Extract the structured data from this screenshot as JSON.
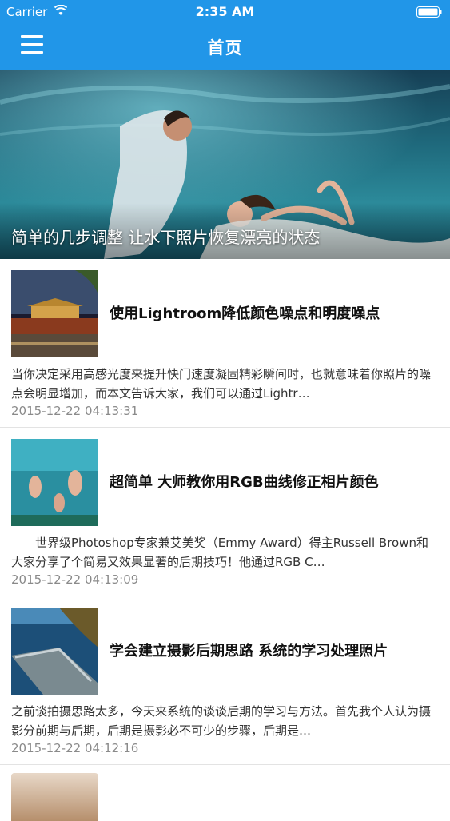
{
  "status_bar": {
    "carrier": "Carrier",
    "time": "2:35 AM"
  },
  "nav": {
    "title": "首页",
    "menu_icon": "hamburger-menu-icon"
  },
  "hero": {
    "caption": "简单的几步调整 让水下照片恢复漂亮的状态"
  },
  "articles": [
    {
      "title": "使用Lightroom降低颜色噪点和明度噪点",
      "summary": "当你决定采用高感光度来提升快门速度凝固精彩瞬间时，也就意味着你照片的噪点会明显增加，而本文告诉大家，我们可以通过Lightr…",
      "date": "2015-12-22 04:13:31"
    },
    {
      "title": "超简单 大师教你用RGB曲线修正相片颜色",
      "summary": "　　世界级Photoshop专家兼艾美奖（Emmy Award）得主Russell Brown和大家分享了个简易又效果显著的后期技巧！他通过RGB C…",
      "date": "2015-12-22 04:13:09"
    },
    {
      "title": "学会建立摄影后期思路 系统的学习处理照片",
      "summary": "之前谈拍摄思路太多，今天来系统的谈谈后期的学习与方法。首先我个人认为摄影分前期与后期，后期是摄影必不可少的步骤，后期是…",
      "date": "2015-12-22 04:12:16"
    }
  ],
  "colors": {
    "nav_bg": "#2196e8",
    "date_text": "#8a8a8a"
  }
}
